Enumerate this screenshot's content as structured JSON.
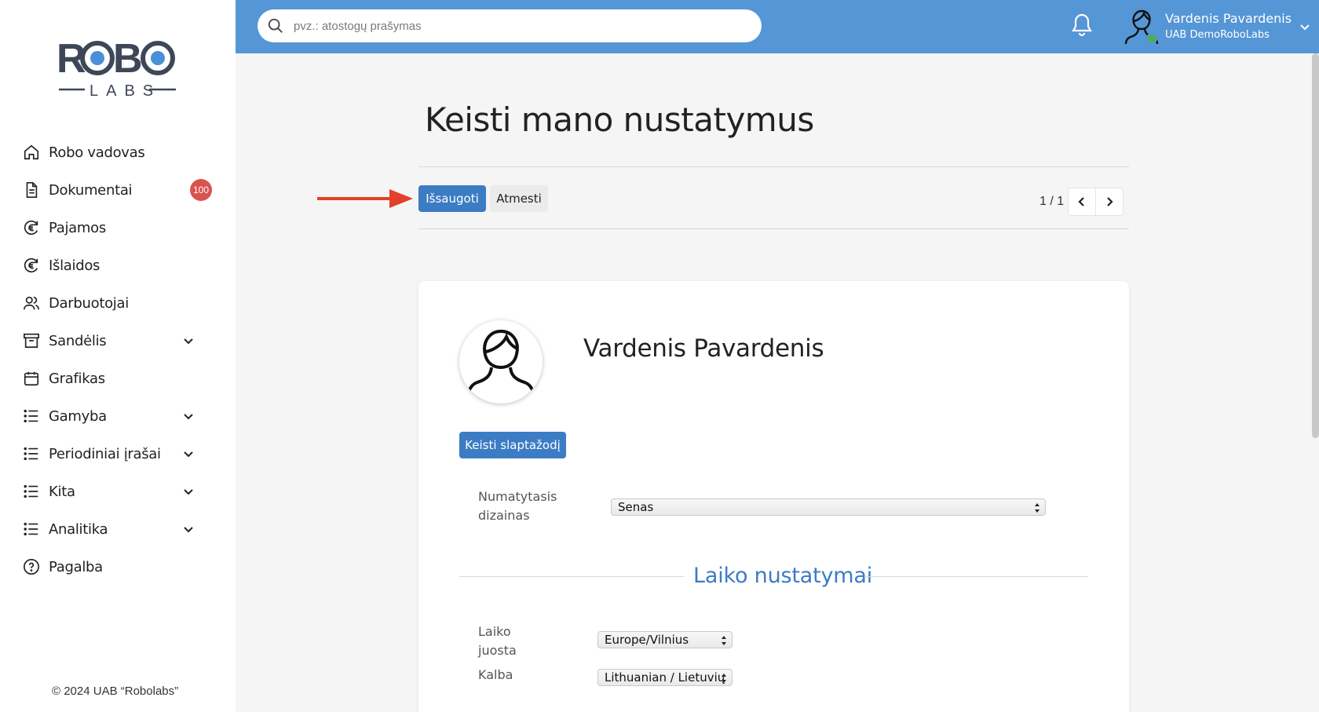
{
  "sidebar": {
    "logo_text": "ROBO LABS",
    "items": [
      {
        "label": "Robo vadovas",
        "icon": "home-icon"
      },
      {
        "label": "Dokumentai",
        "icon": "document-icon",
        "badge": "100"
      },
      {
        "label": "Pajamos",
        "icon": "euro-icon"
      },
      {
        "label": "Išlaidos",
        "icon": "euro-icon"
      },
      {
        "label": "Darbuotojai",
        "icon": "users-icon"
      },
      {
        "label": "Sandėlis",
        "icon": "archive-icon",
        "expandable": true
      },
      {
        "label": "Grafikas",
        "icon": "calendar-icon"
      },
      {
        "label": "Gamyba",
        "icon": "list-icon",
        "expandable": true
      },
      {
        "label": "Periodiniai įrašai",
        "icon": "list-icon",
        "expandable": true
      },
      {
        "label": "Kita",
        "icon": "list-icon",
        "expandable": true
      },
      {
        "label": "Analitika",
        "icon": "list-icon",
        "expandable": true
      },
      {
        "label": "Pagalba",
        "icon": "help-icon"
      }
    ],
    "copyright": "© 2024 UAB “Robolabs”"
  },
  "topbar": {
    "search_placeholder": "pvz.: atostogų prašymas",
    "user_name": "Vardenis Pavardenis",
    "user_company": "UAB DemoRoboLabs",
    "color": "#5596d6"
  },
  "page": {
    "title": "Keisti mano nustatymus",
    "save_label": "Išsaugoti",
    "discard_label": "Atmesti",
    "pager": "1 / 1"
  },
  "profile": {
    "name": "Vardenis Pavardenis",
    "change_password_label": "Keisti slaptažodį",
    "default_design_label_line1": "Numatytasis",
    "default_design_label_line2": "dizainas",
    "default_design_value": "Senas",
    "time_section_title": "Laiko nustatymai",
    "timezone_label_line1": "Laiko",
    "timezone_label_line2": "juosta",
    "timezone_value": "Europe/Vilnius",
    "language_label": "Kalba",
    "language_value": "Lithuanian / Lietuvių"
  },
  "colors": {
    "accent": "#3b7cc4",
    "badge": "#d9534f",
    "arrow": "#e2402a"
  }
}
